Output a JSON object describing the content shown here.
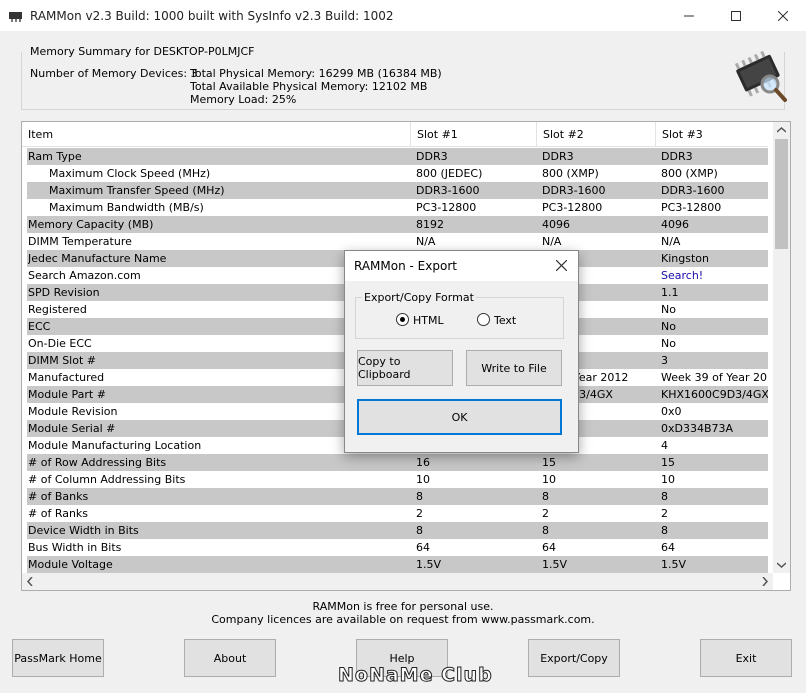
{
  "window": {
    "title": "RAMMon v2.3 Build: 1000 built with SysInfo v2.3 Build: 1002",
    "controls": {
      "minimize": "minimize-icon",
      "maximize": "maximize-icon",
      "close": "close-icon"
    }
  },
  "summary": {
    "legend": "Memory Summary for DESKTOP-P0LMJCF",
    "devices": "Number of Memory Devices: 3",
    "total_physical": "Total Physical Memory: 16299 MB (16384 MB)",
    "total_available": "Total Available Physical Memory: 12102 MB",
    "load": "Memory Load: 25%"
  },
  "table": {
    "headers": [
      "Item",
      "Slot #1",
      "Slot #2",
      "Slot #3"
    ],
    "rows": [
      {
        "item": "Ram Type",
        "s1": "DDR3",
        "s2": "DDR3",
        "s3": "DDR3",
        "shade": true
      },
      {
        "item": "Maximum Clock Speed (MHz)",
        "indent": true,
        "s1": "800 (JEDEC)",
        "s2": "800 (XMP)",
        "s3": "800 (XMP)",
        "shade": false
      },
      {
        "item": "Maximum Transfer Speed (MHz)",
        "indent": true,
        "s1": "DDR3-1600",
        "s2": "DDR3-1600",
        "s3": "DDR3-1600",
        "shade": true
      },
      {
        "item": "Maximum Bandwidth (MB/s)",
        "indent": true,
        "s1": "PC3-12800",
        "s2": "PC3-12800",
        "s3": "PC3-12800",
        "shade": false
      },
      {
        "item": "Memory Capacity (MB)",
        "s1": "8192",
        "s2": "4096",
        "s3": "4096",
        "shade": true
      },
      {
        "item": "DIMM Temperature",
        "s1": "N/A",
        "s2": "N/A",
        "s3": "N/A",
        "shade": false
      },
      {
        "item": "Jedec Manufacture Name",
        "s1": "",
        "s2": "n",
        "s3": "Kingston",
        "shade": true
      },
      {
        "item": "Search Amazon.com",
        "s1": "",
        "s2": "",
        "s3": "Search!",
        "link": true,
        "shade": false
      },
      {
        "item": "SPD Revision",
        "s1": "",
        "s2": "",
        "s3": "1.1",
        "shade": true
      },
      {
        "item": "Registered",
        "s1": "",
        "s2": "",
        "s3": "No",
        "shade": false
      },
      {
        "item": "ECC",
        "s1": "",
        "s2": "",
        "s3": "No",
        "shade": true
      },
      {
        "item": "On-Die ECC",
        "s1": "",
        "s2": "",
        "s3": "No",
        "shade": false
      },
      {
        "item": "DIMM Slot #",
        "s1": "",
        "s2": "",
        "s3": "3",
        "shade": true
      },
      {
        "item": "Manufactured",
        "s1": "",
        "s2": "39 of Year 2012",
        "s3": "Week 39 of Year 2012",
        "shade": false
      },
      {
        "item": "Module Part #",
        "s1": "",
        "s2": "00C9D3/4GX",
        "s3": "KHX1600C9D3/4GX",
        "shade": true
      },
      {
        "item": "Module Revision",
        "s1": "",
        "s2": "",
        "s3": "0x0",
        "shade": false
      },
      {
        "item": "Module Serial #",
        "s1": "",
        "s2": "4B23A",
        "s3": "0xD334B73A",
        "shade": true
      },
      {
        "item": "Module Manufacturing Location",
        "s1": "",
        "s2": "",
        "s3": "4",
        "shade": false
      },
      {
        "item": "# of Row Addressing Bits",
        "s1": "16",
        "s2": "15",
        "s3": "15",
        "shade": true
      },
      {
        "item": "# of Column Addressing Bits",
        "s1": "10",
        "s2": "10",
        "s3": "10",
        "shade": false
      },
      {
        "item": "# of Banks",
        "s1": "8",
        "s2": "8",
        "s3": "8",
        "shade": true
      },
      {
        "item": "# of Ranks",
        "s1": "2",
        "s2": "2",
        "s3": "2",
        "shade": false
      },
      {
        "item": "Device Width in Bits",
        "s1": "8",
        "s2": "8",
        "s3": "8",
        "shade": true
      },
      {
        "item": "Bus Width in Bits",
        "s1": "64",
        "s2": "64",
        "s3": "64",
        "shade": false
      },
      {
        "item": "Module Voltage",
        "s1": "1.5V",
        "s2": "1.5V",
        "s3": "1.5V",
        "shade": true
      }
    ]
  },
  "footer": {
    "line1": "RAMMon is free for personal use.",
    "line2": "Company licences are available on request from www.passmark.com."
  },
  "buttons": {
    "home": "PassMark Home",
    "about": "About",
    "help": "Help",
    "export": "Export/Copy",
    "exit": "Exit"
  },
  "dialog": {
    "title": "RAMMon - Export",
    "group_label": "Export/Copy Format",
    "html_label": "HTML",
    "text_label": "Text",
    "selected": "HTML",
    "copy_label": "Copy to Clipboard",
    "write_label": "Write to File",
    "ok_label": "OK"
  },
  "watermark": "NoNaMe Club",
  "colors": {
    "row_shade": "#c8c8c8",
    "link": "#1a0dab",
    "dialog_focus": "#0078d7"
  }
}
